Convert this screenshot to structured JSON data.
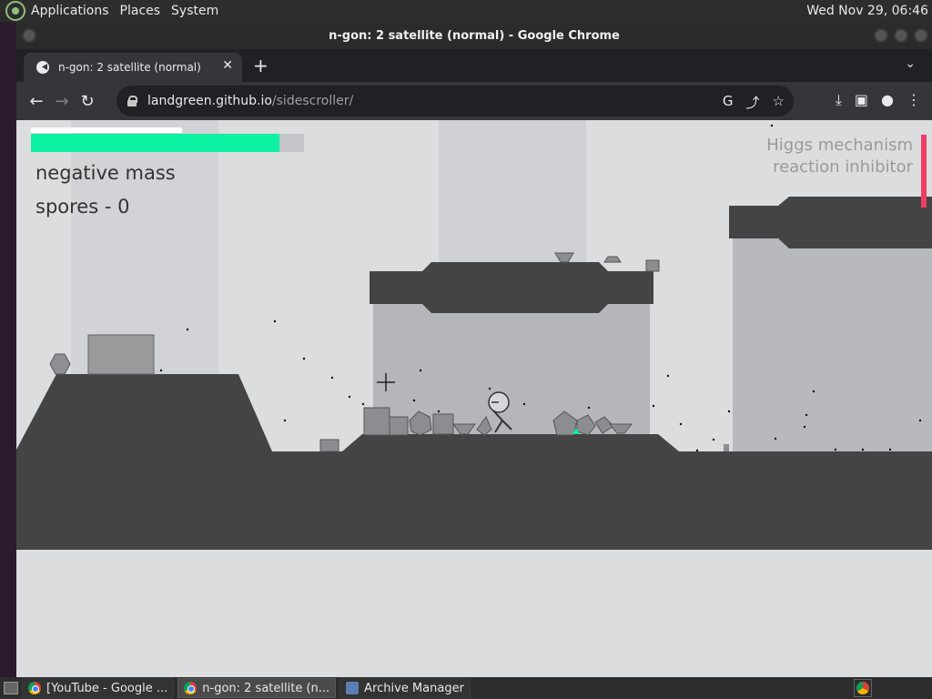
{
  "top_panel": {
    "menus": [
      "Applications",
      "Places",
      "System"
    ],
    "clock": "Wed Nov 29, 06:46"
  },
  "window": {
    "title": "n-gon: 2 satellite (normal) - Google Chrome"
  },
  "browser": {
    "tab_title": "n-gon: 2 satellite (normal)",
    "tab_close": "✕",
    "new_tab": "+",
    "tab_menu": "⌄",
    "url_host": "landgreen.github.io",
    "url_path": "/sidescroller/",
    "nav": {
      "back": "←",
      "forward": "→",
      "reload": "↻"
    },
    "omnibox_icons": [
      "G",
      "⤴",
      "☆"
    ],
    "toolbar_icons": [
      "⤓",
      "▣",
      "●",
      "⋮"
    ]
  },
  "game": {
    "mode_label": "negative mass",
    "spores_label": "spores - 0",
    "tech_line1": "Higgs mechanism",
    "tech_line2": "reaction inhibitor",
    "health_fraction": 0.91,
    "energy_fraction": 0.55,
    "colors": {
      "health": "#0cf2a2",
      "ground": "#444444",
      "bg": "#dcdddf",
      "tech_bar": "#ef3e63"
    }
  },
  "taskbar": {
    "tasks": [
      {
        "label": "[YouTube - Google ...",
        "icon": "chrome-icon",
        "active": false
      },
      {
        "label": "n-gon: 2 satellite (n...",
        "icon": "chrome-icon",
        "active": true
      },
      {
        "label": "Archive Manager",
        "icon": "archive-manager-icon",
        "active": false
      }
    ]
  }
}
